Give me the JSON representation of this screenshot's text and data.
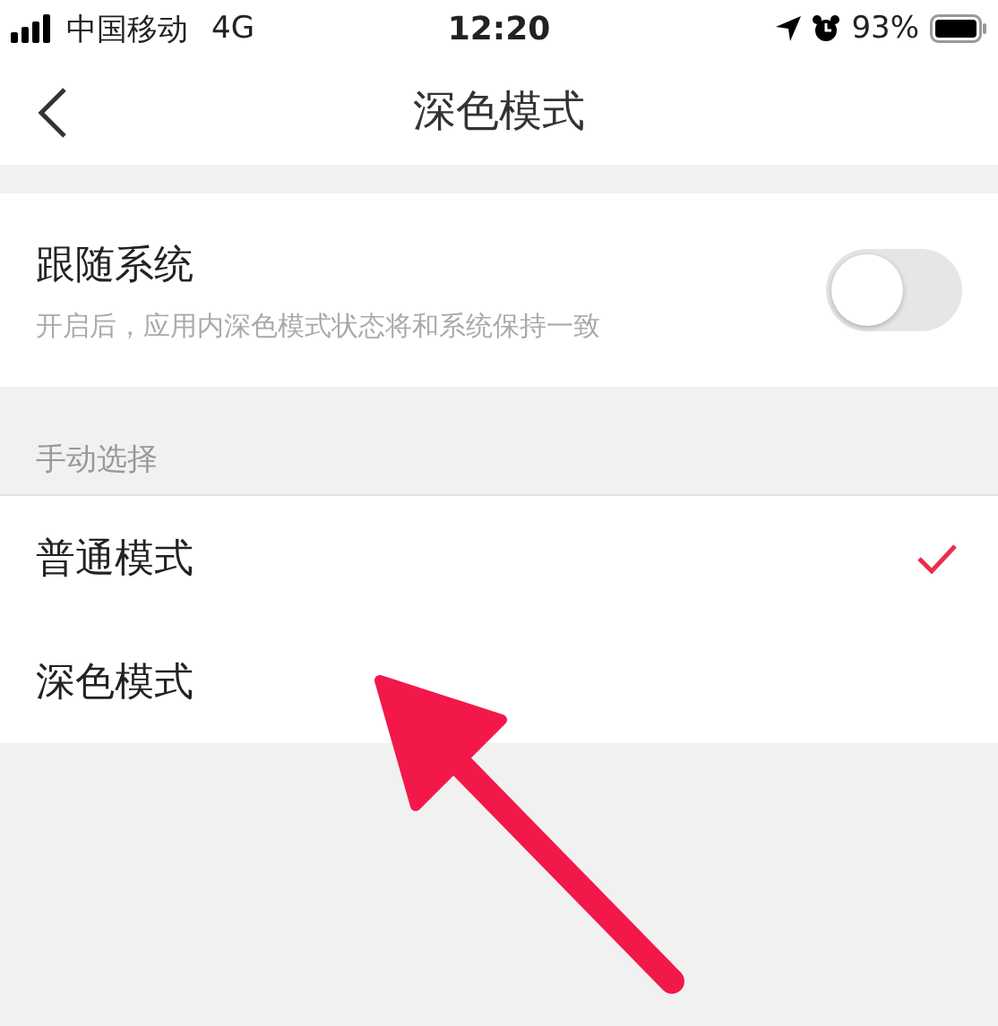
{
  "status_bar": {
    "carrier": "中国移动",
    "network": "4G",
    "time": "12:20",
    "battery": "93%"
  },
  "nav": {
    "title": "深色模式"
  },
  "follow_system": {
    "title": "跟随系统",
    "description": "开启后，应用内深色模式状态将和系统保持一致",
    "on": false
  },
  "section": {
    "label": "手动选择"
  },
  "modes": [
    {
      "label": "普通模式",
      "selected": true
    },
    {
      "label": "深色模式",
      "selected": false
    }
  ]
}
